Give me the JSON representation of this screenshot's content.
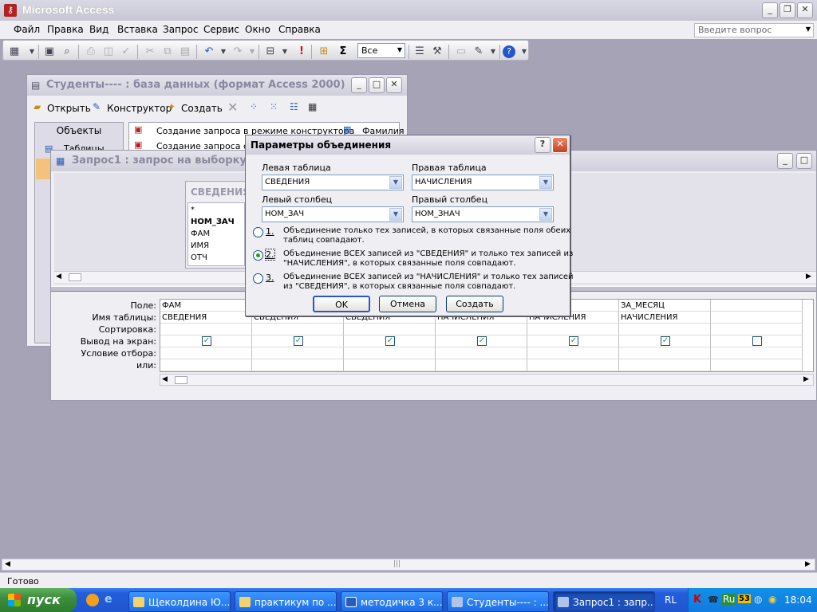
{
  "app": {
    "title": "Microsoft Access"
  },
  "menu": {
    "items": [
      "Файл",
      "Правка",
      "Вид",
      "Вставка",
      "Запрос",
      "Сервис",
      "Окно",
      "Справка"
    ],
    "help_placeholder": "Введите вопрос"
  },
  "toolbar": {
    "top_values": "Все"
  },
  "db_window": {
    "title": "Студенты---- : база данных (формат Access 2000)",
    "open_label": "Открыть",
    "design_label": "Конструктор",
    "create_label": "Создать",
    "objects_header": "Объекты",
    "objects_item": "Таблицы",
    "list": [
      "Создание запроса в режиме конструктора",
      "Создание запроса с по"
    ],
    "right_item": "Фамилия"
  },
  "query_window": {
    "title": "Запрос1 : запрос на выборку",
    "field_list": {
      "title": "СВЕДЕНИЯ",
      "fields": [
        "*",
        "НОМ_ЗАЧ",
        "ФАМ",
        "ИМЯ",
        "ОТЧ"
      ]
    },
    "grid_labels": [
      "Поле:",
      "Имя таблицы:",
      "Сортировка:",
      "Вывод на экран:",
      "Условие отбора:",
      "или:"
    ],
    "columns": [
      {
        "field": "ФАМ",
        "table": "СВЕДЕНИЯ",
        "show": true
      },
      {
        "field": "",
        "table": "СВЕДЕНИЯ",
        "show": true
      },
      {
        "field": "",
        "table": "СВЕДЕНИЯ",
        "show": true
      },
      {
        "field": "",
        "table": "НАЧИСЛЕНИЯ",
        "show": true
      },
      {
        "field": "",
        "table": "НАЧИСЛЕНИЯ",
        "show": true
      },
      {
        "field": "ЗА_МЕСЯЦ",
        "table": "НАЧИСЛЕНИЯ",
        "show": true
      },
      {
        "field": "",
        "table": "",
        "show": false
      }
    ]
  },
  "dialog": {
    "title": "Параметры объединения",
    "left_table_label": "Левая таблица",
    "left_table_value": "СВЕДЕНИЯ",
    "right_table_label": "Правая таблица",
    "right_table_value": "НАЧИСЛЕНИЯ",
    "left_column_label": "Левый столбец",
    "left_column_value": "НОМ_ЗАЧ",
    "right_column_label": "Правый столбец",
    "right_column_value": "НОМ_ЗНАЧ",
    "options": [
      {
        "num": "1.",
        "line1": "Объединение только тех записей, в которых связанные поля обеих",
        "line2": "таблиц совпадают."
      },
      {
        "num": "2.",
        "line1": "Объединение ВСЕХ записей из \"СВЕДЕНИЯ\" и только тех записей из",
        "line2": "\"НАЧИСЛЕНИЯ\", в которых связанные поля совпадают."
      },
      {
        "num": "3.",
        "line1": "Объединение ВСЕХ записей из \"НАЧИСЛЕНИЯ\" и только тех записей",
        "line2": "из \"СВЕДЕНИЯ\", в которых связанные поля совпадают."
      }
    ],
    "selected_option": 2,
    "ok_label": "OK",
    "cancel_label": "Отмена",
    "create_label": "Создать"
  },
  "status": {
    "text": "Готово"
  },
  "taskbar": {
    "start_label": "пуск",
    "tasks": [
      "Щеколдина Ю....",
      "практикум по ...",
      "методичка 3 к...",
      "Студенты---- : ...",
      "Запрос1 : запр..."
    ],
    "lang": "RL",
    "tray_lang": "Ru",
    "clock": "18:04"
  },
  "colors": {
    "accent": "#245edb",
    "titlebar_inactive": "#c0bfd0",
    "dialog_title": "#d6d5e2"
  }
}
